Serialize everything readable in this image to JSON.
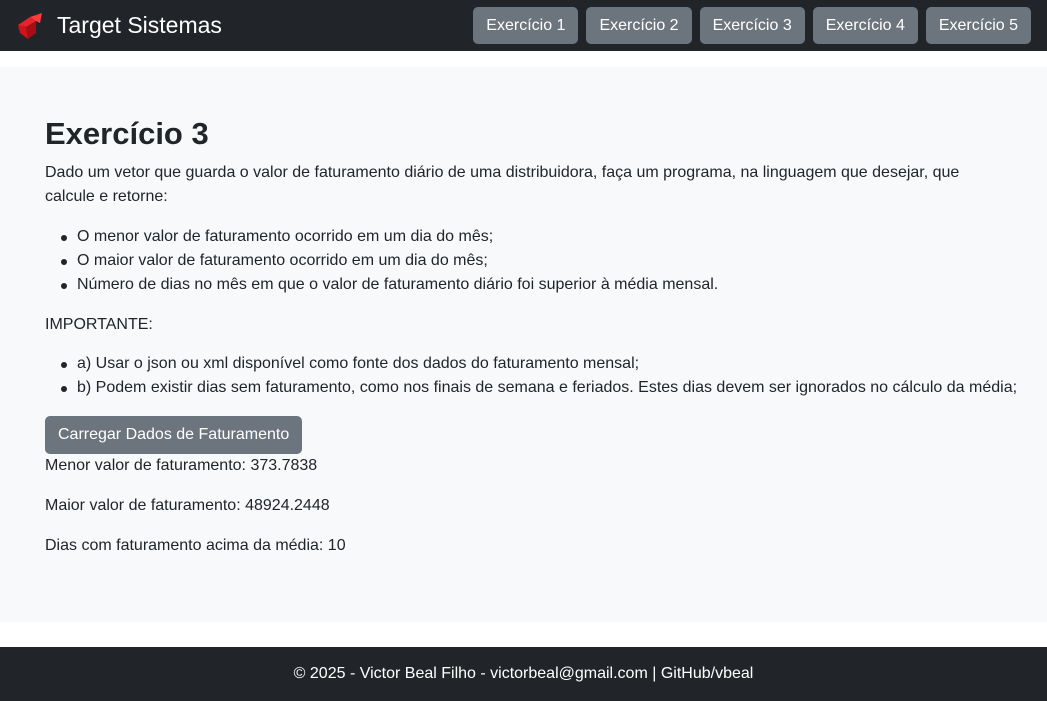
{
  "navbar": {
    "brand": "Target Sistemas",
    "logo_icon": "red-arrow-logo-icon",
    "buttons": [
      "Exercício 1",
      "Exercício 2",
      "Exercício 3",
      "Exercício 4",
      "Exercício 5"
    ]
  },
  "main": {
    "title": "Exercício 3",
    "description": "Dado um vetor que guarda o valor de faturamento diário de uma distribuidora, faça um programa, na linguagem que desejar, que calcule e retorne:",
    "requirements": [
      "O menor valor de faturamento ocorrido em um dia do mês;",
      "O maior valor de faturamento ocorrido em um dia do mês;",
      "Número de dias no mês em que o valor de faturamento diário foi superior à média mensal."
    ],
    "important_label": "IMPORTANTE:",
    "important_notes": [
      "a) Usar o json ou xml disponível como fonte dos dados do faturamento mensal;",
      "b) Podem existir dias sem faturamento, como nos finais de semana e feriados. Estes dias devem ser ignorados no cálculo da média;"
    ],
    "load_button": "Carregar Dados de Faturamento",
    "results": {
      "min": "Menor valor de faturamento: 373.7838",
      "max": "Maior valor de faturamento: 48924.2448",
      "above_avg": "Dias com faturamento acima da média: 10"
    }
  },
  "footer": {
    "text": "© 2025 - Victor Beal Filho - victorbeal@gmail.com",
    "separator": "|",
    "link": "GitHub/vbeal"
  },
  "colors": {
    "navbar_bg": "#212529",
    "button_bg": "#6c757d",
    "main_bg": "#f8f9fa",
    "logo_red": "#d0121b"
  }
}
